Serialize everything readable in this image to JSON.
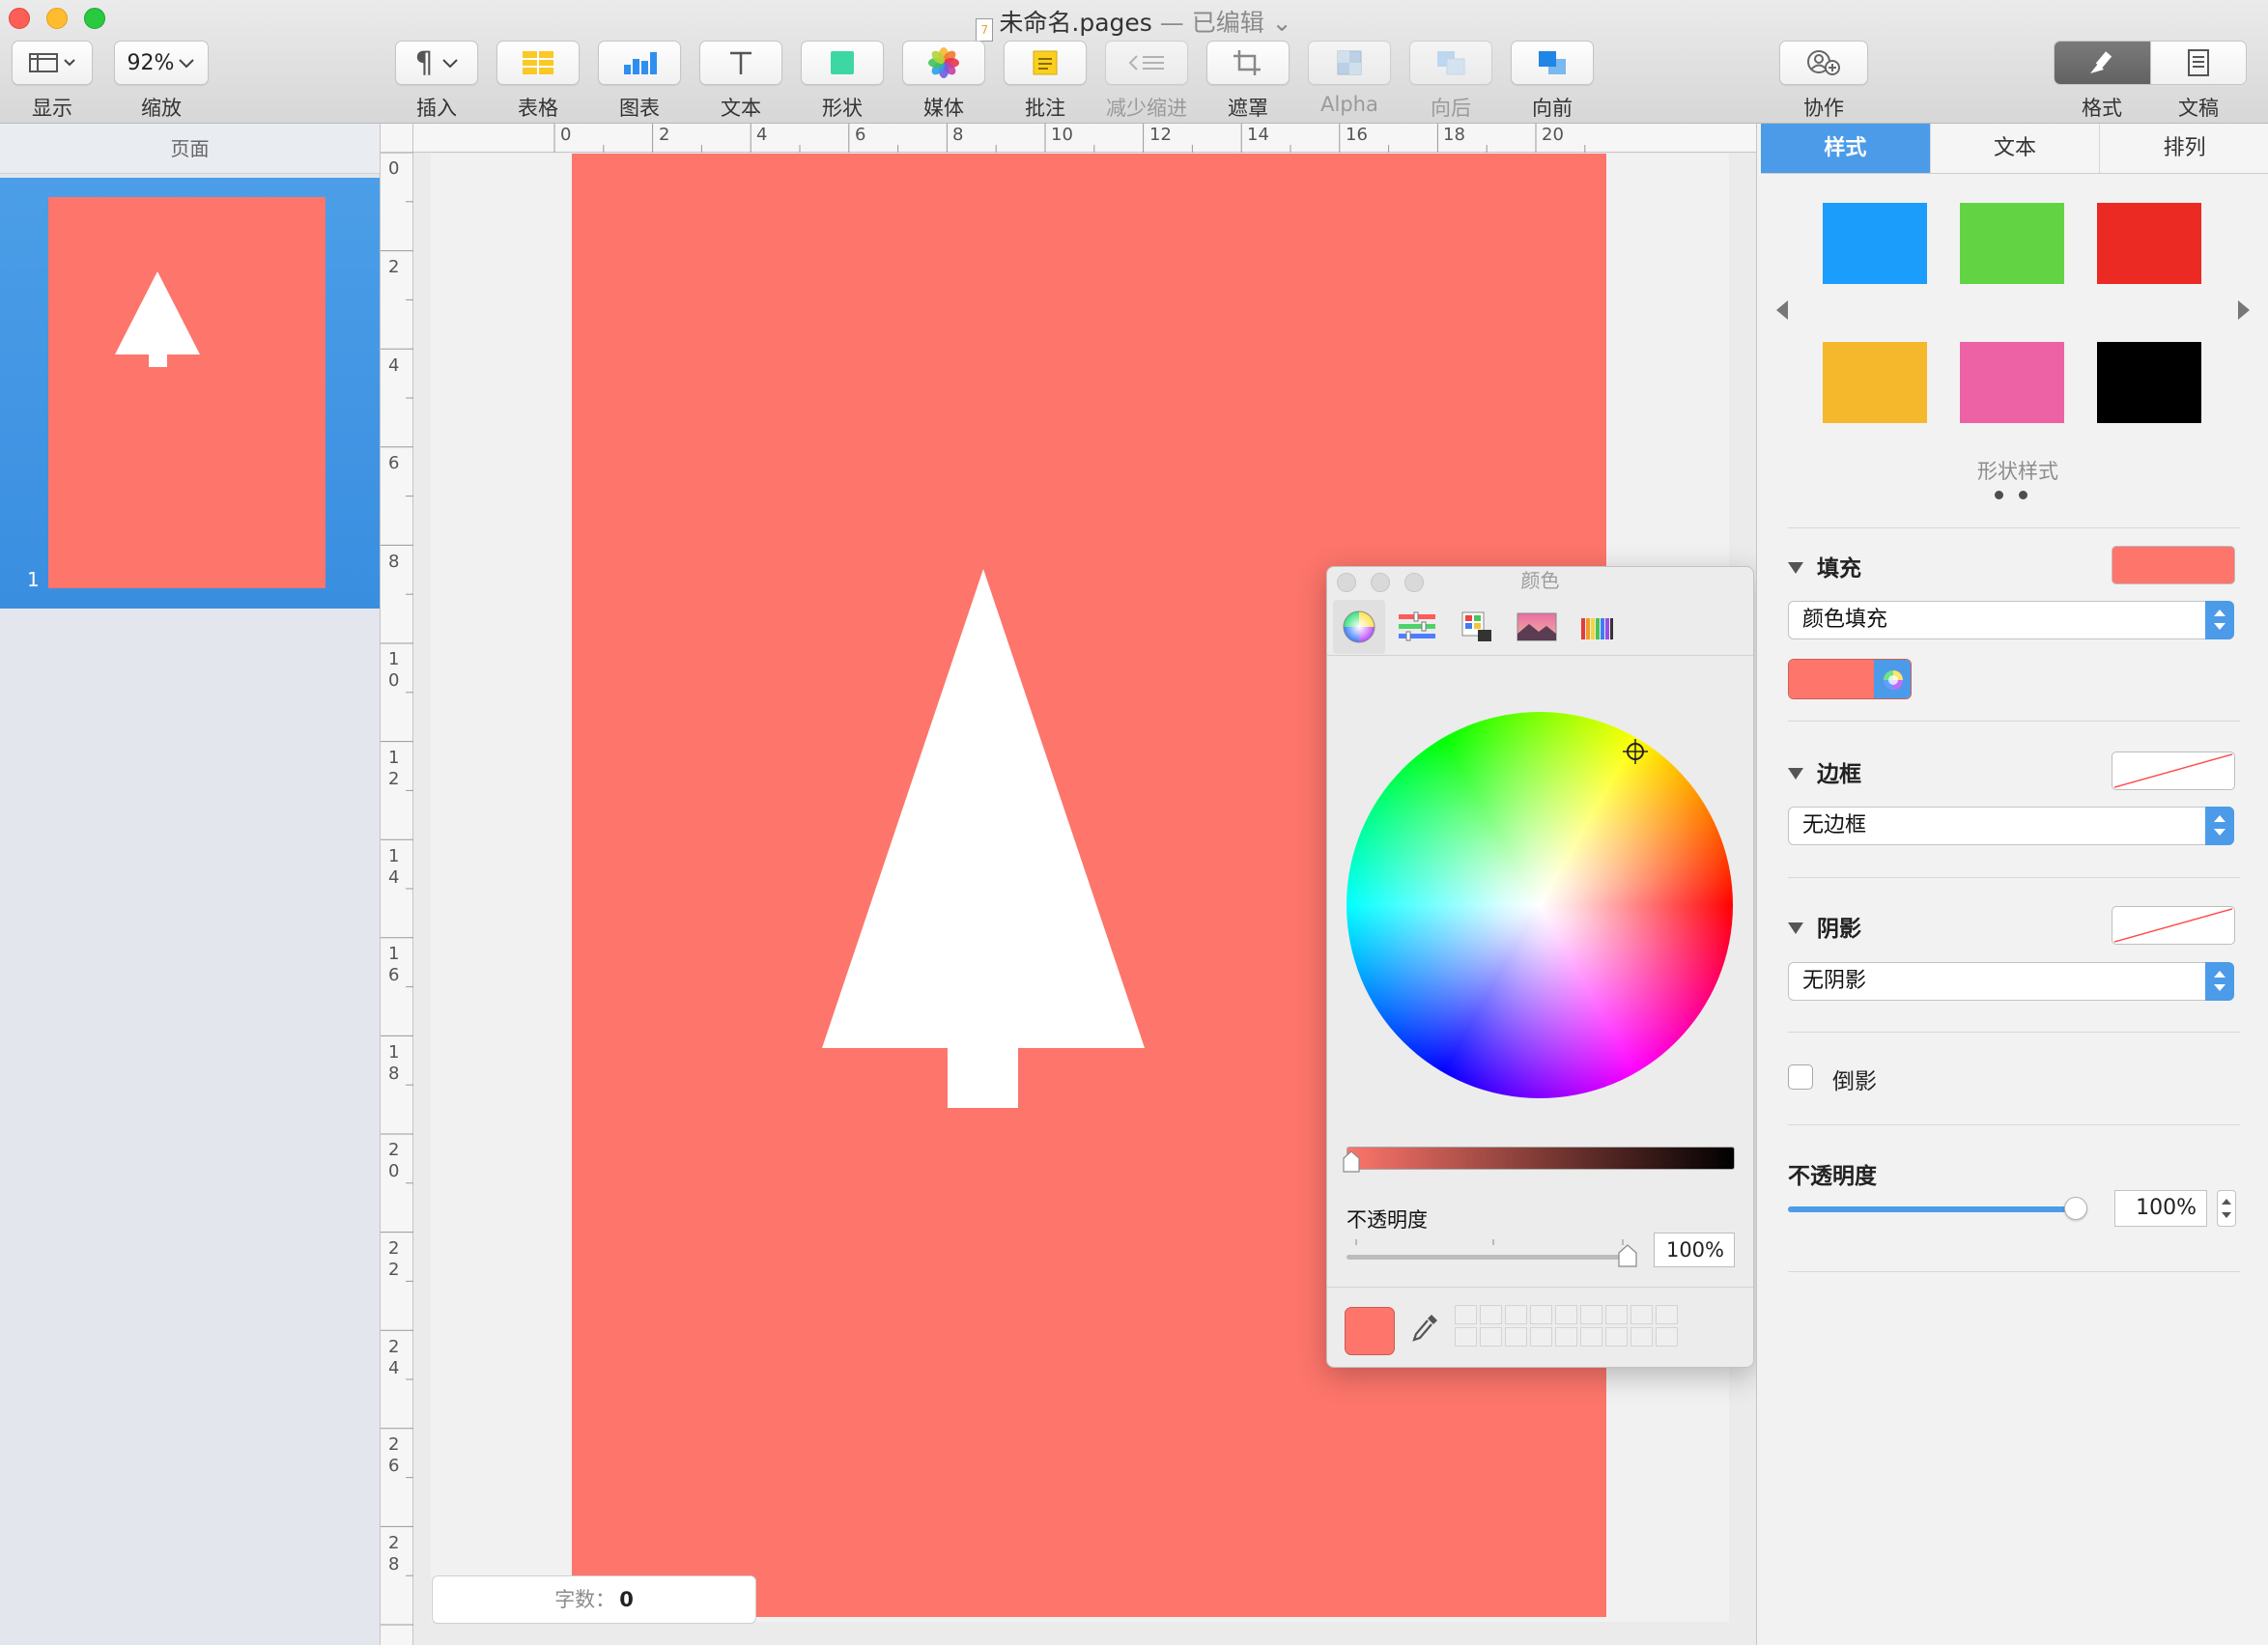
{
  "window": {
    "title": "未命名.pages",
    "edited_suffix": "— 已编辑"
  },
  "toolbar": {
    "view_label": "显示",
    "zoom_value": "92%",
    "zoom_label": "缩放",
    "insert_label": "插入",
    "table_label": "表格",
    "chart_label": "图表",
    "text_label": "文本",
    "shape_label": "形状",
    "media_label": "媒体",
    "comment_label": "批注",
    "decrease_indent_label": "减少缩进",
    "mask_label": "遮罩",
    "alpha_label": "Alpha",
    "backward_label": "向后",
    "forward_label": "向前",
    "collaborate_label": "协作",
    "format_label": "格式",
    "document_label": "文稿"
  },
  "sidebar": {
    "header": "页面",
    "pages": [
      {
        "number": "1"
      }
    ]
  },
  "rulers": {
    "horizontal": [
      "0",
      "2",
      "4",
      "6",
      "8",
      "10",
      "12",
      "14",
      "16",
      "18",
      "20"
    ],
    "vertical": [
      "0",
      "2",
      "4",
      "6",
      "8",
      "1\n0",
      "1\n2",
      "1\n4",
      "1\n6",
      "1\n8",
      "2\n0",
      "2\n2",
      "2\n4",
      "2\n6",
      "2\n8"
    ]
  },
  "status": {
    "word_count_label": "字数：",
    "word_count_value": "0"
  },
  "color_panel": {
    "title": "颜色",
    "opacity_label": "不透明度",
    "opacity_value": "100%",
    "current_color": "#fd756b"
  },
  "inspector": {
    "tabs": [
      {
        "label": "样式",
        "selected": true
      },
      {
        "label": "文本",
        "selected": false
      },
      {
        "label": "排列",
        "selected": false
      }
    ],
    "shape_styles_label": "形状样式",
    "shape_style_colors": [
      "#1a9dfb",
      "#62d444",
      "#ec2a24",
      "#f5b82d",
      "#ec62a5",
      "#000000"
    ],
    "fill": {
      "title": "填充",
      "color": "#fd756b",
      "type": "颜色填充"
    },
    "border": {
      "title": "边框",
      "type": "无边框"
    },
    "shadow": {
      "title": "阴影",
      "type": "无阴影"
    },
    "reflection_label": "倒影",
    "opacity": {
      "title": "不透明度",
      "value": "100%"
    }
  },
  "colors": {
    "page_background": "#fd756b",
    "accent": "#4b9be9"
  }
}
